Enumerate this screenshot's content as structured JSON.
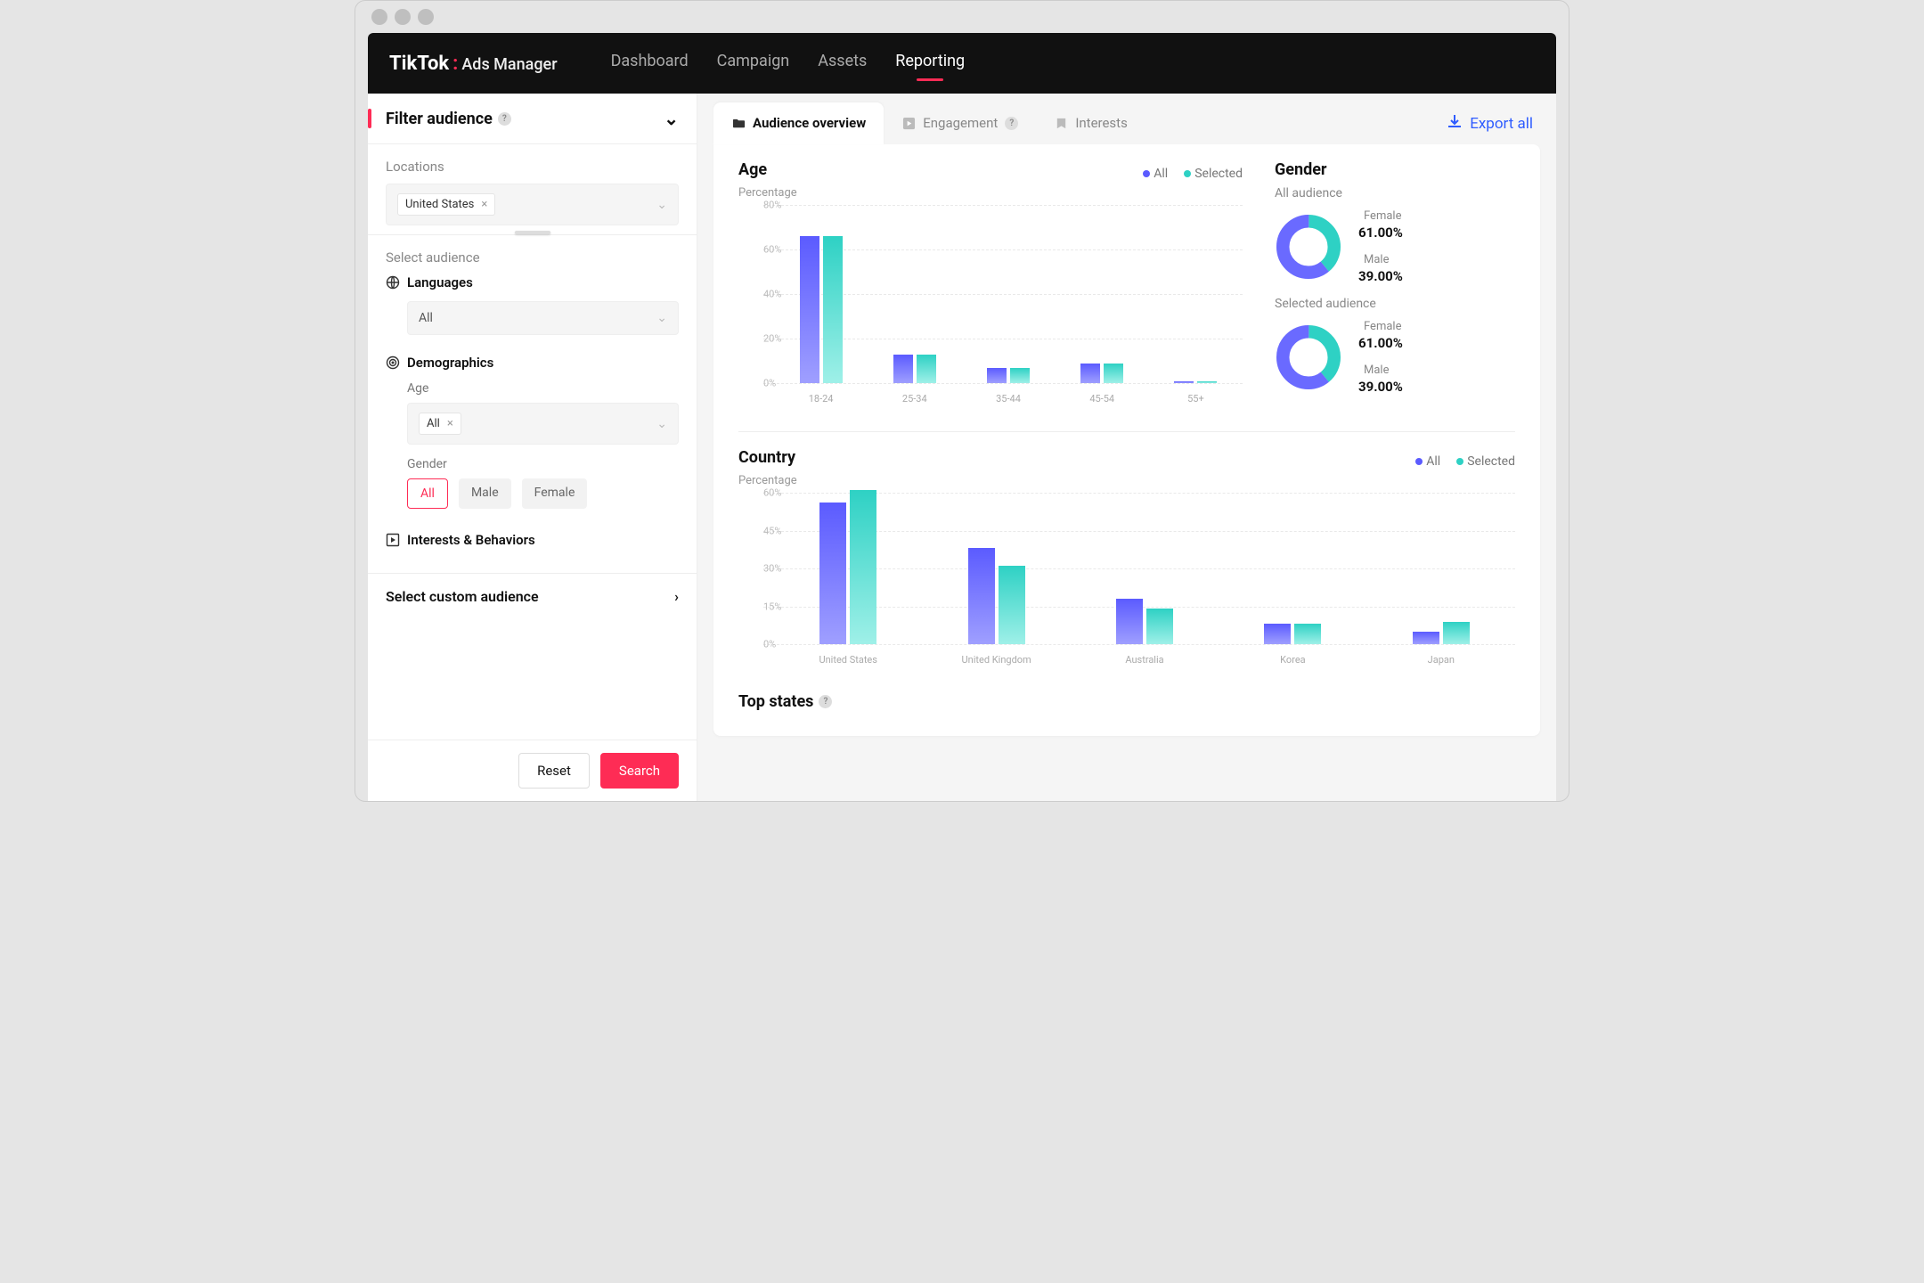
{
  "brand": {
    "name": "TikTok",
    "sub": "Ads Manager"
  },
  "nav": {
    "dashboard": "Dashboard",
    "campaign": "Campaign",
    "assets": "Assets",
    "reporting": "Reporting"
  },
  "sidebar": {
    "filter_title": "Filter audience",
    "locations_label": "Locations",
    "location_chip": "United States",
    "select_audience": "Select audience",
    "languages_label": "Languages",
    "languages_value": "All",
    "demographics_label": "Demographics",
    "age_label": "Age",
    "age_value": "All",
    "gender_label": "Gender",
    "gender_all": "All",
    "gender_male": "Male",
    "gender_female": "Female",
    "interests_behaviors": "Interests & Behaviors",
    "select_custom": "Select custom audience",
    "reset": "Reset",
    "search": "Search"
  },
  "tabs": {
    "overview": "Audience overview",
    "engagement": "Engagement",
    "interests": "Interests"
  },
  "export_all": "Export all",
  "legend": {
    "all": "All",
    "selected": "Selected"
  },
  "age_section": {
    "title": "Age",
    "subtitle": "Percentage"
  },
  "gender_section": {
    "title": "Gender",
    "all_label": "All audience",
    "sel_label": "Selected audience",
    "female": "Female",
    "male": "Male",
    "all_female_pct": "61.00%",
    "all_male_pct": "39.00%",
    "sel_female_pct": "61.00%",
    "sel_male_pct": "39.00%"
  },
  "country_section": {
    "title": "Country",
    "subtitle": "Percentage"
  },
  "top_states": "Top states",
  "colors": {
    "all": "#5b5bff",
    "selected": "#2ed1c4"
  },
  "chart_data": [
    {
      "type": "bar",
      "title": "Age",
      "ylabel": "Percentage",
      "ylim": [
        0,
        80
      ],
      "categories": [
        "18-24",
        "25-34",
        "35-44",
        "45-54",
        "55+"
      ],
      "series": [
        {
          "name": "All",
          "values": [
            66,
            13,
            7,
            9,
            1
          ]
        },
        {
          "name": "Selected",
          "values": [
            66,
            13,
            7,
            9,
            1
          ]
        }
      ]
    },
    {
      "type": "bar",
      "title": "Country",
      "ylabel": "Percentage",
      "ylim": [
        0,
        60
      ],
      "categories": [
        "United States",
        "United Kingdom",
        "Australia",
        "Korea",
        "Japan"
      ],
      "series": [
        {
          "name": "All",
          "values": [
            56,
            38,
            18,
            8,
            5
          ]
        },
        {
          "name": "Selected",
          "values": [
            61,
            31,
            14,
            8,
            9
          ]
        }
      ]
    },
    {
      "type": "pie",
      "title": "Gender – All audience",
      "categories": [
        "Female",
        "Male"
      ],
      "values": [
        61,
        39
      ]
    },
    {
      "type": "pie",
      "title": "Gender – Selected audience",
      "categories": [
        "Female",
        "Male"
      ],
      "values": [
        61,
        39
      ]
    }
  ]
}
